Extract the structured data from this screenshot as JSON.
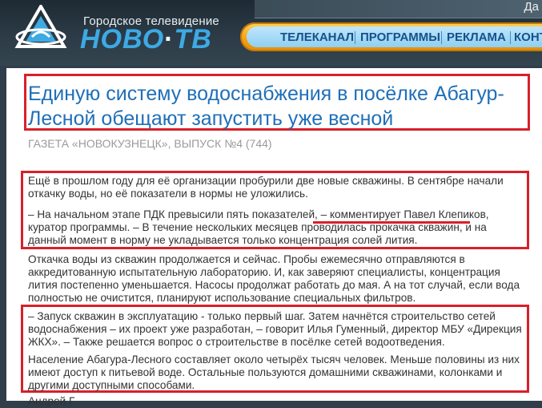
{
  "header": {
    "tagline": "Городское телевидение",
    "brand_left": "НОВО",
    "brand_dot": "·",
    "brand_right": "ТВ",
    "top_link": "Да",
    "nav": [
      "ТЕЛЕКАНАЛ",
      "ПРОГРАММЫ",
      "РЕКЛАМА",
      "КОНТ"
    ],
    "colors": {
      "nav_orange": "#f6a312",
      "nav_blue": "#8fd0f2",
      "brand_blue": "#3fa9e2",
      "highlight_red": "#d8202a"
    }
  },
  "article": {
    "title": "Единую систему водоснабжения в посёлке Абагур-Лесной обещают запустить уже весной",
    "source": "ГАЗЕТА «НОВОКУЗНЕЦК», ВЫПУСК №4 (744)",
    "paragraphs": [
      "Ещё в прошлом году для её организации пробурили две новые скважины. В сентябре начали откачку воды, но её показатели в нормы не уложились.",
      "– На начальном этапе ПДК превысили пять показателей, – комментирует Павел Клепиков, куратор программы. – В течение нескольких месяцев проводилась прокачка скважин, и на данный момент в норму не укладывается только концентрация солей лития.",
      "Откачка воды из скважин продолжается и сейчас. Пробы ежемесячно отправляются в аккредитованную испытательную лабораторию. И, как заверяют специалисты, концентрация лития постепенно уменьшается. Насосы продолжат работать до мая. А на тот случай, если вода полностью не очистится, планируют использование специальных фильтров.",
      "– Запуск скважин в эксплуатацию - только первый шаг. Затем начнётся строительство сетей водоснабжения – их проект уже разработан, – говорит Илья Гуменный, директор МБУ «Дирекция ЖКХ». – Также решается вопрос о строительстве в посёлке сетей водоотведения.",
      "Население Абагура-Лесного составляет около четырёх тысяч человек. Меньше половины из них имеют доступ к питьевой воде. Остальные пользуются домашними скважинами, колонками и другими доступными способами."
    ],
    "author_fragment": "Андрей Г"
  }
}
